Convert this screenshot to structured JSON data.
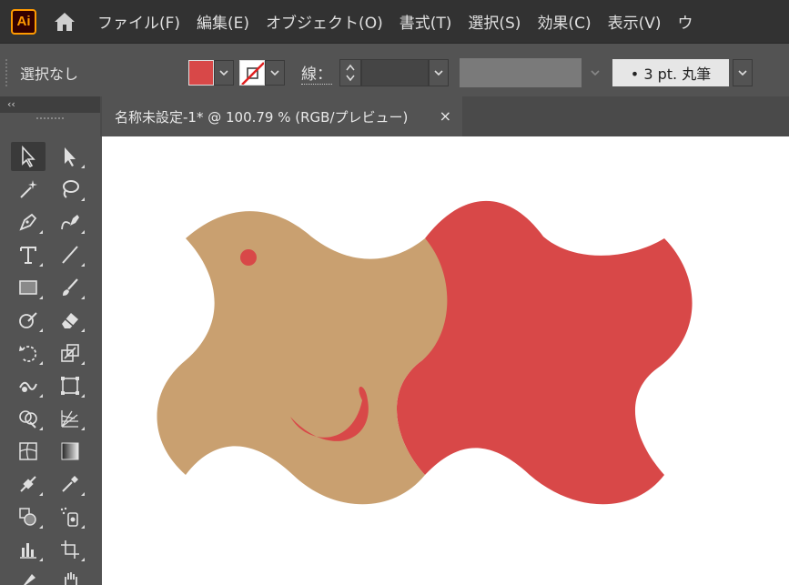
{
  "app": {
    "logo_text": "Ai",
    "menu": [
      "ファイル(F)",
      "編集(E)",
      "オブジェクト(O)",
      "書式(T)",
      "選択(S)",
      "効果(C)",
      "表示(V)",
      "ウ"
    ]
  },
  "control_bar": {
    "selection_label": "選択なし",
    "fill_color": "#d84848",
    "stroke_label": "線：",
    "stroke_value": "",
    "brush_label": "•  3 pt. 丸筆"
  },
  "toolbar": {
    "collapse_label": "‹‹"
  },
  "document": {
    "tab_title": "名称未設定-1* @ 100.79 % (RGB/プレビュー)",
    "close_label": "×"
  },
  "artwork": {
    "tan_color": "#c9a070",
    "red_color": "#d84848"
  }
}
